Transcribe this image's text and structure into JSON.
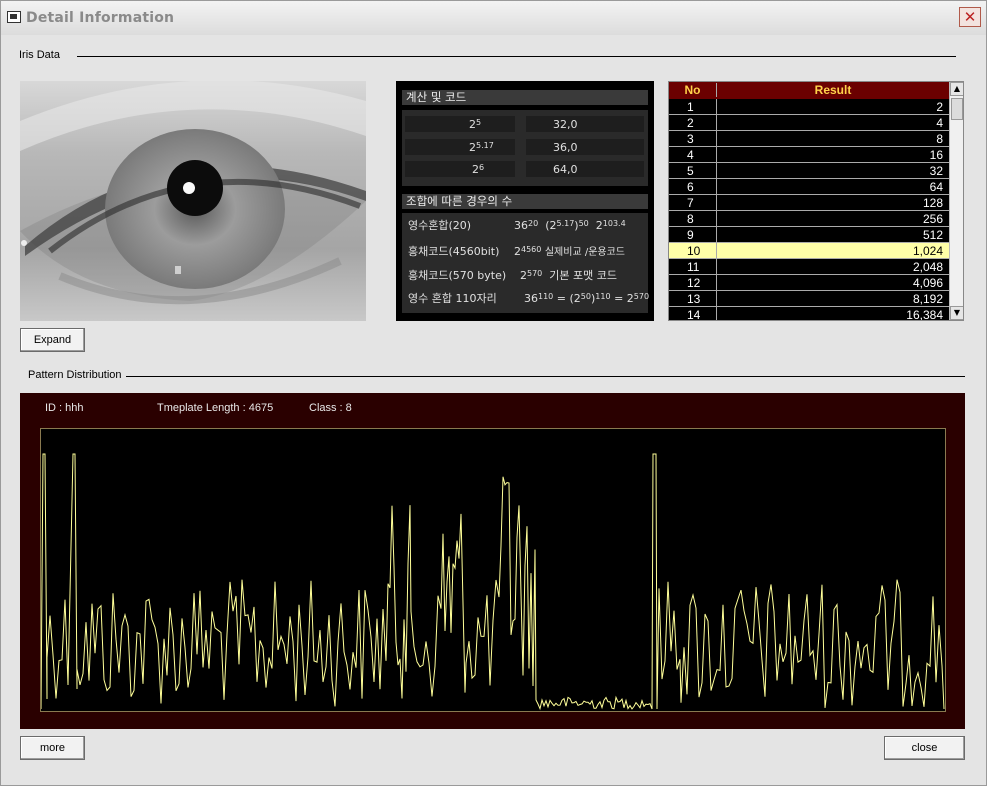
{
  "window": {
    "title": "Detail Information",
    "close_symbol": "✕"
  },
  "iris_group": {
    "label": "Iris Data"
  },
  "expand_button": {
    "label": "Expand"
  },
  "calc": {
    "header1": "계산 및 코드",
    "header2": "조합에 따른 경우의 수",
    "rows": [
      {
        "base": "2",
        "exp": "5",
        "value": "32,0"
      },
      {
        "base": "2",
        "exp": "5.17",
        "value": "36,0"
      },
      {
        "base": "2",
        "exp": "6",
        "value": "64,0"
      }
    ],
    "combos": [
      {
        "label": "영수혼합(20)",
        "b1": "36",
        "e1": "20",
        "p": "(2",
        "pe": "5.17",
        "pc": ")",
        "pe2": "50",
        "b3": "2",
        "e3": "103.4"
      },
      {
        "label": "홍채코드(4560bit)",
        "b1": "2",
        "e1": "4560",
        "note": "실제비교 /운용코드"
      },
      {
        "label": "홍채코드(570 byte)",
        "b1": "2",
        "e1": "570",
        "note": "기본 포맷 코드"
      },
      {
        "label": "영수 혼합 110자리",
        "b1": "36",
        "e1": "110",
        "eq": "= (2",
        "pe": "50",
        "pc": ")",
        "pe2": "110",
        "eq2": "= 2",
        "e3": "570"
      }
    ]
  },
  "table": {
    "headers": [
      "No",
      "Result"
    ],
    "rows": [
      [
        "1",
        "2"
      ],
      [
        "2",
        "4"
      ],
      [
        "3",
        "8"
      ],
      [
        "4",
        "16"
      ],
      [
        "5",
        "32"
      ],
      [
        "6",
        "64"
      ],
      [
        "7",
        "128"
      ],
      [
        "8",
        "256"
      ],
      [
        "9",
        "512"
      ],
      [
        "10",
        "1,024"
      ],
      [
        "11",
        "2,048"
      ],
      [
        "12",
        "4,096"
      ],
      [
        "13",
        "8,192"
      ],
      [
        "14",
        "16,384"
      ]
    ],
    "selected_row": 10,
    "scroll_up": "▲",
    "scroll_down": "▼"
  },
  "pattern_group": {
    "label": "Pattern Distribution"
  },
  "pattern": {
    "id_text": "ID : hhh",
    "length_text": "Tmeplate Length :  4675",
    "class_text": "Class :  8",
    "line_color": "#ffff99",
    "bg_color": "#2a0000"
  },
  "buttons": {
    "more": "more",
    "close": "close"
  },
  "colors": {
    "table_header_bg": "#6b0000",
    "table_header_fg": "#ffd24a",
    "selected_row": "#ffffa8"
  }
}
